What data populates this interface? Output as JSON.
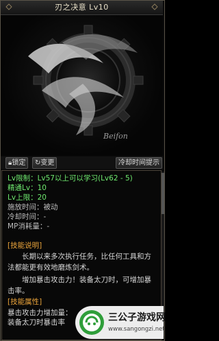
{
  "window": {
    "title": "刃之决意 Lv10"
  },
  "art": {
    "logo_text": "Beifon"
  },
  "toolbar": {
    "lock_label": "锁定",
    "change_label": "变更",
    "cooldown_label": "冷却时间提示"
  },
  "info": {
    "lv_limit": "Lv限制：Lv57以上可以学习(Lv62 - 5)",
    "mastery": "精通Lv：10",
    "lv_cap": "Lv上限：20",
    "cast_time": "施放时间：被动",
    "cooldown": "冷却时间：-",
    "mp_cost": "MP消耗量：-"
  },
  "description": {
    "header": "[技能说明]",
    "text_1": "　　长期以来多次执行任务，比任何工具和方法都能更有效地磨炼剑术。",
    "text_2": "　　增加暴击攻击力！装备太刀时，可增加暴击率。"
  },
  "attributes": {
    "header": "[技能属性]",
    "line_1": "暴击攻击力增加量：",
    "line_2": "装备太刀时暴击率"
  },
  "watermark": {
    "name": "三公子游戏网",
    "url": "www.sangongzi.net"
  }
}
